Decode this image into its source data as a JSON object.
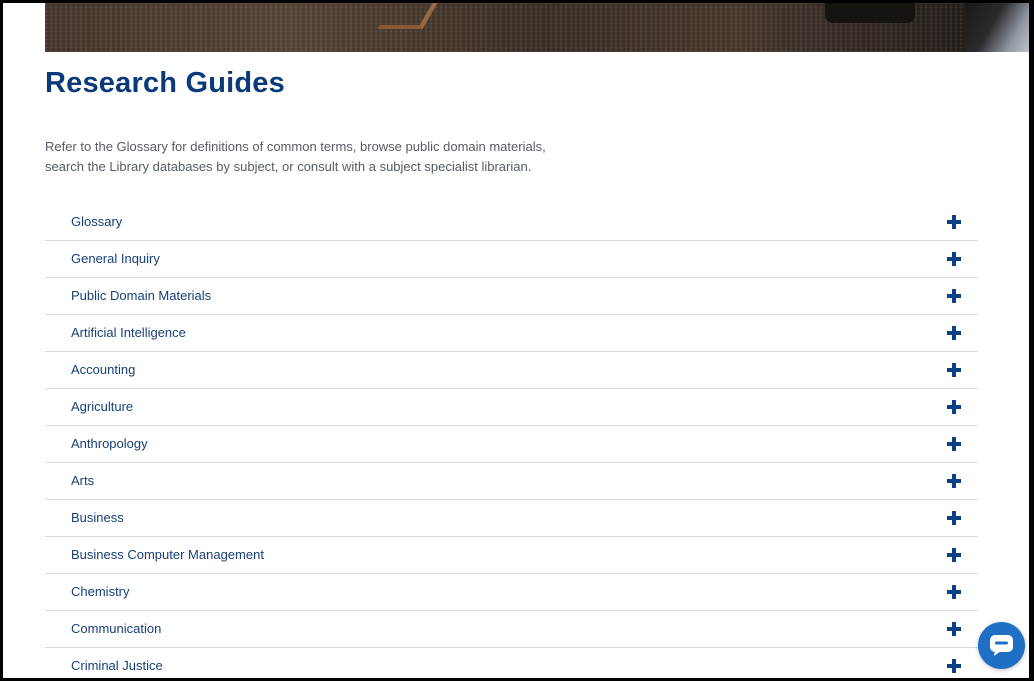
{
  "page": {
    "title": "Research Guides",
    "intro_line1": "Refer to the Glossary for definitions of common terms, browse public domain materials,",
    "intro_line2": "search the Library databases by subject, or consult with a subject specialist librarian."
  },
  "accordion": {
    "items": [
      {
        "label": "Glossary"
      },
      {
        "label": "General Inquiry"
      },
      {
        "label": "Public Domain Materials"
      },
      {
        "label": "Artificial Intelligence"
      },
      {
        "label": "Accounting"
      },
      {
        "label": "Agriculture"
      },
      {
        "label": "Anthropology"
      },
      {
        "label": "Arts"
      },
      {
        "label": "Business"
      },
      {
        "label": "Business Computer Management"
      },
      {
        "label": "Chemistry"
      },
      {
        "label": "Communication"
      },
      {
        "label": "Criminal Justice"
      }
    ],
    "expand_icon": "plus-icon"
  },
  "chat": {
    "icon": "chat-icon"
  },
  "colors": {
    "title": "#0a3a7a",
    "link": "#173f78",
    "icon": "#0d3f86",
    "chat": "#1f6fc5"
  }
}
